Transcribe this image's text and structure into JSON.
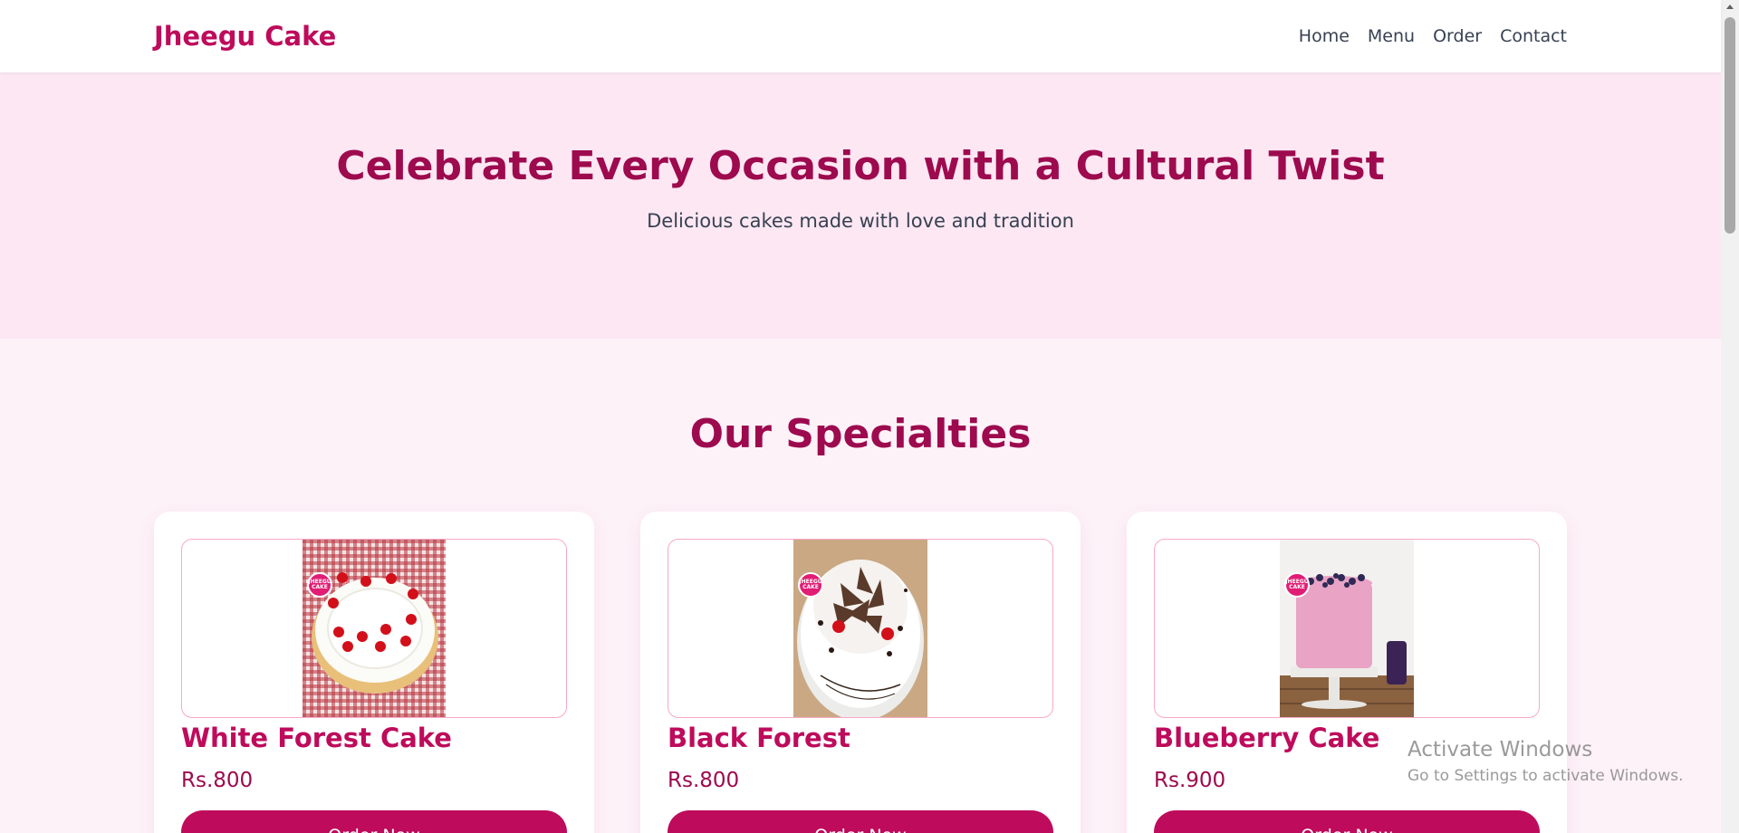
{
  "navbar": {
    "brand": "Jheegu Cake",
    "links": [
      "Home",
      "Menu",
      "Order",
      "Contact"
    ]
  },
  "hero": {
    "title": "Celebrate Every Occasion with a Cultural Twist",
    "subtitle": "Delicious cakes made with love and tradition"
  },
  "specialties": {
    "title": "Our Specialties",
    "items": [
      {
        "name": "White Forest Cake",
        "price": "Rs.800",
        "button": "Order Now",
        "badge": "JHEEGU CAKE",
        "image": "white-forest-cake-photo"
      },
      {
        "name": "Black Forest",
        "price": "Rs.800",
        "button": "Order Now",
        "badge": "JHEEGU CAKE",
        "image": "black-forest-cake-photo"
      },
      {
        "name": "Blueberry Cake",
        "price": "Rs.900",
        "button": "Order Now",
        "badge": "JHEEGU CAKE",
        "image": "blueberry-cake-photo"
      }
    ]
  },
  "watermark": {
    "title": "Activate Windows",
    "subtitle": "Go to Settings to activate Windows."
  },
  "colors": {
    "brand": "#be0b5b",
    "heading": "#9d0a4e",
    "hero_bg": "#fce7f3",
    "section_bg": "#fdf2f8"
  }
}
